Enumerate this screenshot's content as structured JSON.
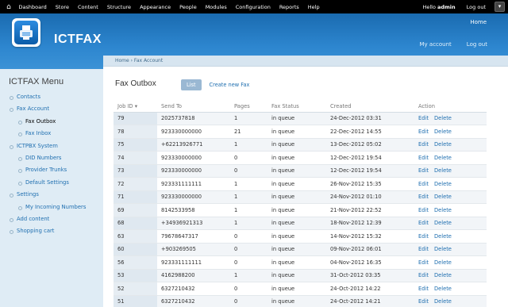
{
  "toolbar": {
    "items": [
      "Dashboard",
      "Store",
      "Content",
      "Structure",
      "Appearance",
      "People",
      "Modules",
      "Configuration",
      "Reports",
      "Help"
    ],
    "hello_prefix": "Hello ",
    "username": "admin",
    "logout": "Log out"
  },
  "header": {
    "site_name": "ICTFAX",
    "secondary_home": "Home",
    "my_account": "My account",
    "logout": "Log out"
  },
  "sidebar": {
    "title": "ICTFAX Menu",
    "items": [
      {
        "label": "Contacts",
        "level": 0
      },
      {
        "label": "Fax Account",
        "level": 0
      },
      {
        "label": "Fax Outbox",
        "level": 1,
        "active": true
      },
      {
        "label": "Fax Inbox",
        "level": 1
      },
      {
        "label": "ICTPBX System",
        "level": 0
      },
      {
        "label": "DID Numbers",
        "level": 1
      },
      {
        "label": "Provider Trunks",
        "level": 1
      },
      {
        "label": "Default Settings",
        "level": 1
      },
      {
        "label": "Settings",
        "level": 0
      },
      {
        "label": "My Incoming Numbers",
        "level": 1
      },
      {
        "label": "Add content",
        "level": 0
      },
      {
        "label": "Shopping cart",
        "level": 0
      }
    ]
  },
  "main": {
    "breadcrumb": "Home › Fax Account",
    "title": "Fax Outbox",
    "tab_list": "List",
    "tab_new": "Create new Fax",
    "columns": [
      "Job ID",
      "Send To",
      "Pages",
      "Fax Status",
      "Created",
      "Action"
    ],
    "sort_indicator": "▾",
    "action_edit": "Edit",
    "action_delete": "Delete",
    "rows": [
      {
        "id": "79",
        "to": "2025737818",
        "pages": "1",
        "status": "in queue",
        "created": "24-Dec-2012 03:31"
      },
      {
        "id": "78",
        "to": "923330000000",
        "pages": "21",
        "status": "in queue",
        "created": "22-Dec-2012 14:55"
      },
      {
        "id": "75",
        "to": "+62213926771",
        "pages": "1",
        "status": "in queue",
        "created": "13-Dec-2012 05:02"
      },
      {
        "id": "74",
        "to": "923330000000",
        "pages": "0",
        "status": "in queue",
        "created": "12-Dec-2012 19:54"
      },
      {
        "id": "73",
        "to": "923330000000",
        "pages": "0",
        "status": "in queue",
        "created": "12-Dec-2012 19:54"
      },
      {
        "id": "72",
        "to": "923331111111",
        "pages": "1",
        "status": "in queue",
        "created": "26-Nov-2012 15:35"
      },
      {
        "id": "71",
        "to": "923330000000",
        "pages": "1",
        "status": "in queue",
        "created": "24-Nov-2012 01:10"
      },
      {
        "id": "69",
        "to": "8142533958",
        "pages": "1",
        "status": "in queue",
        "created": "21-Nov-2012 22:52"
      },
      {
        "id": "68",
        "to": "+34936921313",
        "pages": "1",
        "status": "in queue",
        "created": "18-Nov-2012 12:39"
      },
      {
        "id": "63",
        "to": "79678647317",
        "pages": "0",
        "status": "in queue",
        "created": "14-Nov-2012 15:32"
      },
      {
        "id": "60",
        "to": "+903269505",
        "pages": "0",
        "status": "in queue",
        "created": "09-Nov-2012 06:01"
      },
      {
        "id": "56",
        "to": "923331111111",
        "pages": "0",
        "status": "in queue",
        "created": "04-Nov-2012 16:35"
      },
      {
        "id": "53",
        "to": "4162988200",
        "pages": "1",
        "status": "in queue",
        "created": "31-Oct-2012 03:35"
      },
      {
        "id": "52",
        "to": "6327210432",
        "pages": "0",
        "status": "in queue",
        "created": "24-Oct-2012 14:22"
      },
      {
        "id": "51",
        "to": "6327210432",
        "pages": "0",
        "status": "in queue",
        "created": "24-Oct-2012 14:21"
      }
    ]
  }
}
